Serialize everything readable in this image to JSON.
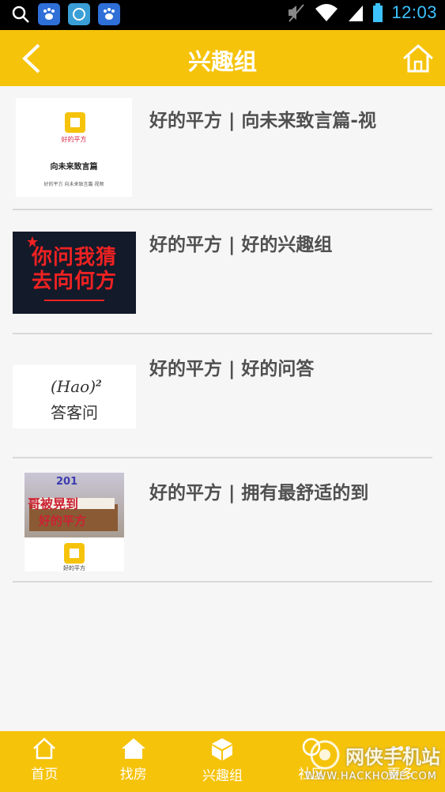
{
  "status_bar": {
    "time": "12:03",
    "icons": [
      "search-icon",
      "baidu-icon",
      "app-icon",
      "baidu-icon",
      "mute-icon",
      "wifi-icon",
      "signal-icon",
      "battery-icon"
    ]
  },
  "header": {
    "title": "兴趣组",
    "back_icon": "chevron-left-icon",
    "home_icon": "home-icon"
  },
  "items": [
    {
      "title": "好的平方 | 向未来致言篇-视",
      "thumb": {
        "logo_text": "好的平方",
        "line1": "向未来致言篇",
        "line2": "好的平方 向未来致言篇 视频"
      }
    },
    {
      "title": "好的平方 | 好的兴趣组",
      "thumb": {
        "line1": "你问我猜",
        "line2": "去向何方"
      }
    },
    {
      "title": "好的平方 | 好的问答",
      "thumb": {
        "line1": "(Hao)",
        "sup": "2",
        "line2": "答客问"
      }
    },
    {
      "title": "好的平方 | 拥有最舒适的到",
      "thumb": {
        "line1": "201",
        "line2": "哥被晃到",
        "line3": "好的平方",
        "logo_text": "好的平方"
      }
    }
  ],
  "bottom_nav": [
    {
      "label": "首页",
      "icon": "home-outline-icon"
    },
    {
      "label": "找房",
      "icon": "house-icon"
    },
    {
      "label": "兴趣组",
      "icon": "cube-icon"
    },
    {
      "label": "社区",
      "icon": "community-icon"
    },
    {
      "label": "更多",
      "icon": "more-icon"
    }
  ],
  "watermark": {
    "text": "网侠手机站",
    "sub": "WWW.HACKHOME.COM"
  },
  "colors": {
    "accent": "#f6c30b",
    "background": "#f6f6f6",
    "title_text": "#505050",
    "time": "#3cc3ff"
  }
}
